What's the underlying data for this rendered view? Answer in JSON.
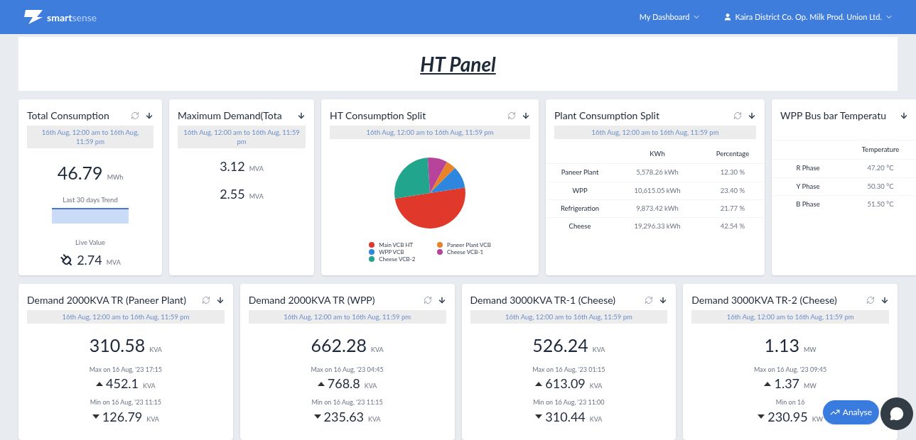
{
  "header": {
    "logo_bold": "smart",
    "logo_light": "sense",
    "nav": [
      {
        "kind": "dropdown",
        "label": "My Dashboard"
      },
      {
        "kind": "user",
        "label": "Kaira District Co. Op. Milk Prod. Union Ltd."
      }
    ]
  },
  "page_title": "HT Panel",
  "cards": [
    {
      "kind": "total",
      "title": "Total Consumption",
      "refreshable": true,
      "date_range": "16th Aug, 12:00 am to 16th Aug, 11:59 pm",
      "value": "46.79",
      "unit": "MWh",
      "trend_label": "Last 30 days Trend",
      "live_label": "Live Value",
      "live_value": "2.74",
      "live_unit": "MVA"
    },
    {
      "kind": "max_demand",
      "title": "Maximum Demand(Tota",
      "refreshable": false,
      "date_range": "16th Aug, 12:00 am to 16th Aug, 11:59 pm",
      "values": [
        {
          "value": "3.12",
          "unit": "MVA"
        },
        {
          "value": "2.55",
          "unit": "MVA"
        }
      ]
    },
    {
      "kind": "pie",
      "title": "HT Consumption Split",
      "refreshable": true,
      "date_range": "16th Aug, 12:00 am to 16th Aug, 11:59 pm",
      "legend": [
        {
          "label": "Main VCB HT",
          "color": "#e0382b"
        },
        {
          "label": "Paneer Plant VCB",
          "color": "#e8832a"
        },
        {
          "label": "WPP VCB",
          "color": "#2e86de"
        },
        {
          "label": "Cheese VCB-1",
          "color": "#b8439a"
        },
        {
          "label": "Cheese VCB-2",
          "color": "#21a68d"
        }
      ]
    },
    {
      "kind": "table",
      "title": "Plant Consumption Split",
      "refreshable": true,
      "date_range": "16th Aug, 12:00 am to 16th Aug, 11:59 pm",
      "columns": [
        "KWh",
        "Percentage"
      ],
      "rows": [
        {
          "name": "Paneer Plant",
          "kwh": "5,578.26 kWh",
          "percentage": "12.30 %"
        },
        {
          "name": "WPP",
          "kwh": "10,615.05 kWh",
          "percentage": "23.40 %"
        },
        {
          "name": "Refrigeration",
          "kwh": "9,873.42 kWh",
          "percentage": "21.77 %"
        },
        {
          "name": "Cheese",
          "kwh": "19,296.33 kWh",
          "percentage": "42.54 %"
        }
      ]
    },
    {
      "kind": "temperature",
      "title": "WPP Bus bar Temperatu",
      "refreshable": false,
      "column": "Temperature",
      "rows": [
        {
          "name": "R Phase",
          "value": "47.20 °C"
        },
        {
          "name": "Y Phase",
          "value": "50.30 °C"
        },
        {
          "name": "B Phase",
          "value": "51.50 °C"
        }
      ]
    }
  ],
  "demand_cards": [
    {
      "title": "Demand 2000KVA TR (Paneer Plant)",
      "refreshable": true,
      "date_range": "16th Aug, 12:00 am to 16th Aug, 11:59 pm",
      "value": "310.58",
      "unit": "KVA",
      "max_label": "Max on 16 Aug, '23 17:15",
      "max_value": "452.1",
      "max_unit": "KVA",
      "min_label": "Min on 16 Aug, '23 11:15",
      "min_value": "126.79",
      "min_unit": "KVA"
    },
    {
      "title": "Demand 2000KVA TR (WPP)",
      "refreshable": true,
      "date_range": "16th Aug, 12:00 am to 16th Aug, 11:59 pm",
      "value": "662.28",
      "unit": "KVA",
      "max_label": "Max on 16 Aug, '23 04:45",
      "max_value": "768.8",
      "max_unit": "KVA",
      "min_label": "Min on 16 Aug, '23 11:15",
      "min_value": "235.63",
      "min_unit": "KVA"
    },
    {
      "title": "Demand 3000KVA TR-1 (Cheese)",
      "refreshable": true,
      "date_range": "16th Aug, 12:00 am to 16th Aug, 11:59 pm",
      "value": "526.24",
      "unit": "KVA",
      "max_label": "Max on 16 Aug, '23 01:15",
      "max_value": "613.09",
      "max_unit": "KVA",
      "min_label": "Min on 16 Aug, '23 11:00",
      "min_value": "310.44",
      "min_unit": "KVA"
    },
    {
      "title": "Demand 3000KVA TR-2 (Cheese)",
      "refreshable": true,
      "date_range": "16th Aug, 12:00 am to 16th Aug, 11:59 pm",
      "value": "1.13",
      "unit": "MW",
      "max_label": "Max on 16 Aug, '23 09:45",
      "max_value": "1.37",
      "max_unit": "MW",
      "min_label": "Min on 16",
      "min_value": "230.95",
      "min_unit": "KW"
    }
  ],
  "analyse_button": "Analyse"
}
